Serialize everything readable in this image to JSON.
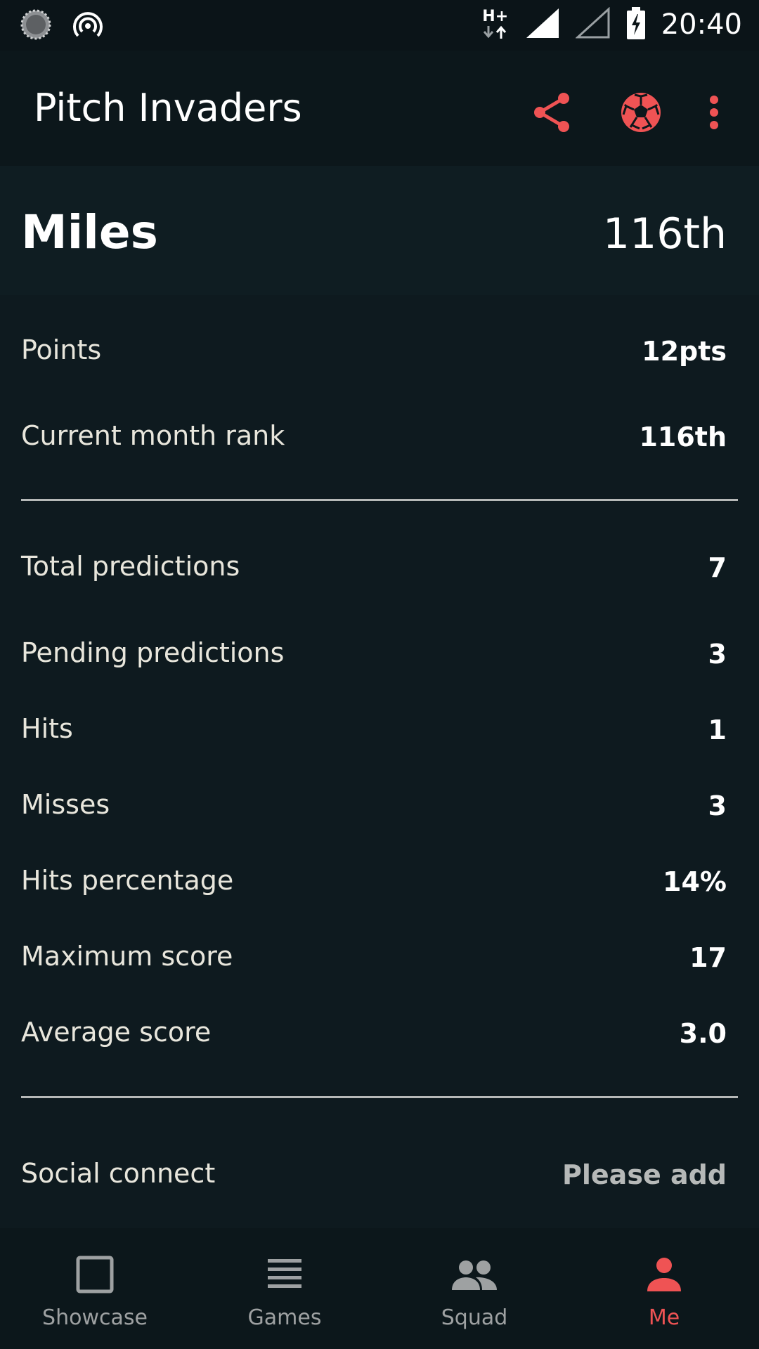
{
  "status_bar": {
    "network_type": "H+",
    "time": "20:40",
    "icons": [
      "spinner-icon",
      "hotspot-icon",
      "data-arrows-icon",
      "signal-full-icon",
      "signal-empty-icon",
      "battery-charging-icon"
    ]
  },
  "app_bar": {
    "title": "Pitch Invaders",
    "actions": [
      "share-icon",
      "soccer-ball-icon",
      "more-vert-icon"
    ],
    "accent_color": "#ef5354"
  },
  "profile": {
    "name": "Miles",
    "rank": "116th"
  },
  "stats_group_1": [
    {
      "label": "Points",
      "value": "12pts"
    },
    {
      "label": "Current month rank",
      "value": "116th"
    }
  ],
  "stats_group_2": [
    {
      "label": "Total predictions",
      "value": "7"
    },
    {
      "label": "Pending predictions",
      "value": "3"
    },
    {
      "label": "Hits",
      "value": "1"
    },
    {
      "label": "Misses",
      "value": "3"
    },
    {
      "label": "Hits percentage",
      "value": "14%"
    },
    {
      "label": "Maximum score",
      "value": "17"
    },
    {
      "label": "Average score",
      "value": "3.0"
    }
  ],
  "social": {
    "label": "Social connect",
    "value": "Please add"
  },
  "bottom_nav": {
    "items": [
      {
        "label": "Showcase",
        "icon": "square-icon"
      },
      {
        "label": "Games",
        "icon": "list-icon"
      },
      {
        "label": "Squad",
        "icon": "group-icon"
      },
      {
        "label": "Me",
        "icon": "person-icon",
        "active": true
      }
    ],
    "active_color": "#ef5354",
    "inactive_color": "#9ea1a2"
  }
}
